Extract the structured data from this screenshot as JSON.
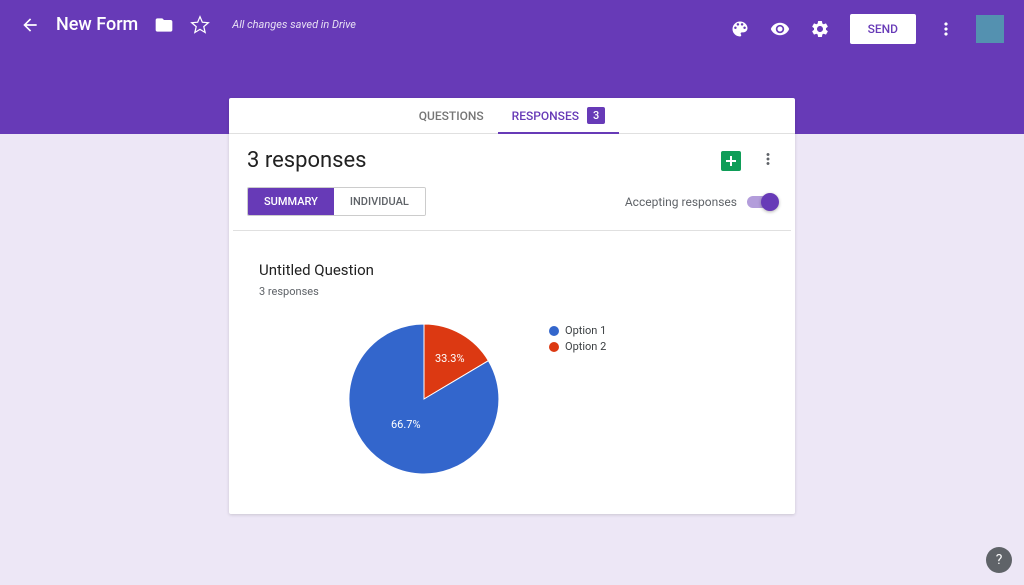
{
  "header": {
    "form_title": "New Form",
    "saved_text": "All changes saved in Drive",
    "send_label": "SEND"
  },
  "tabs": {
    "questions": "QUESTIONS",
    "responses": "RESPONSES",
    "response_count": "3"
  },
  "responses": {
    "title": "3 responses",
    "summary_label": "SUMMARY",
    "individual_label": "INDIVIDUAL",
    "accepting_label": "Accepting responses"
  },
  "question": {
    "title": "Untitled Question",
    "subtitle": "3 responses"
  },
  "chart_data": {
    "type": "pie",
    "title": "Untitled Question",
    "series": [
      {
        "name": "Option 1",
        "value": 66.7,
        "label": "66.7%",
        "color": "#3366cc"
      },
      {
        "name": "Option 2",
        "value": 33.3,
        "label": "33.3%",
        "color": "#dc3912"
      }
    ]
  },
  "help": "?"
}
